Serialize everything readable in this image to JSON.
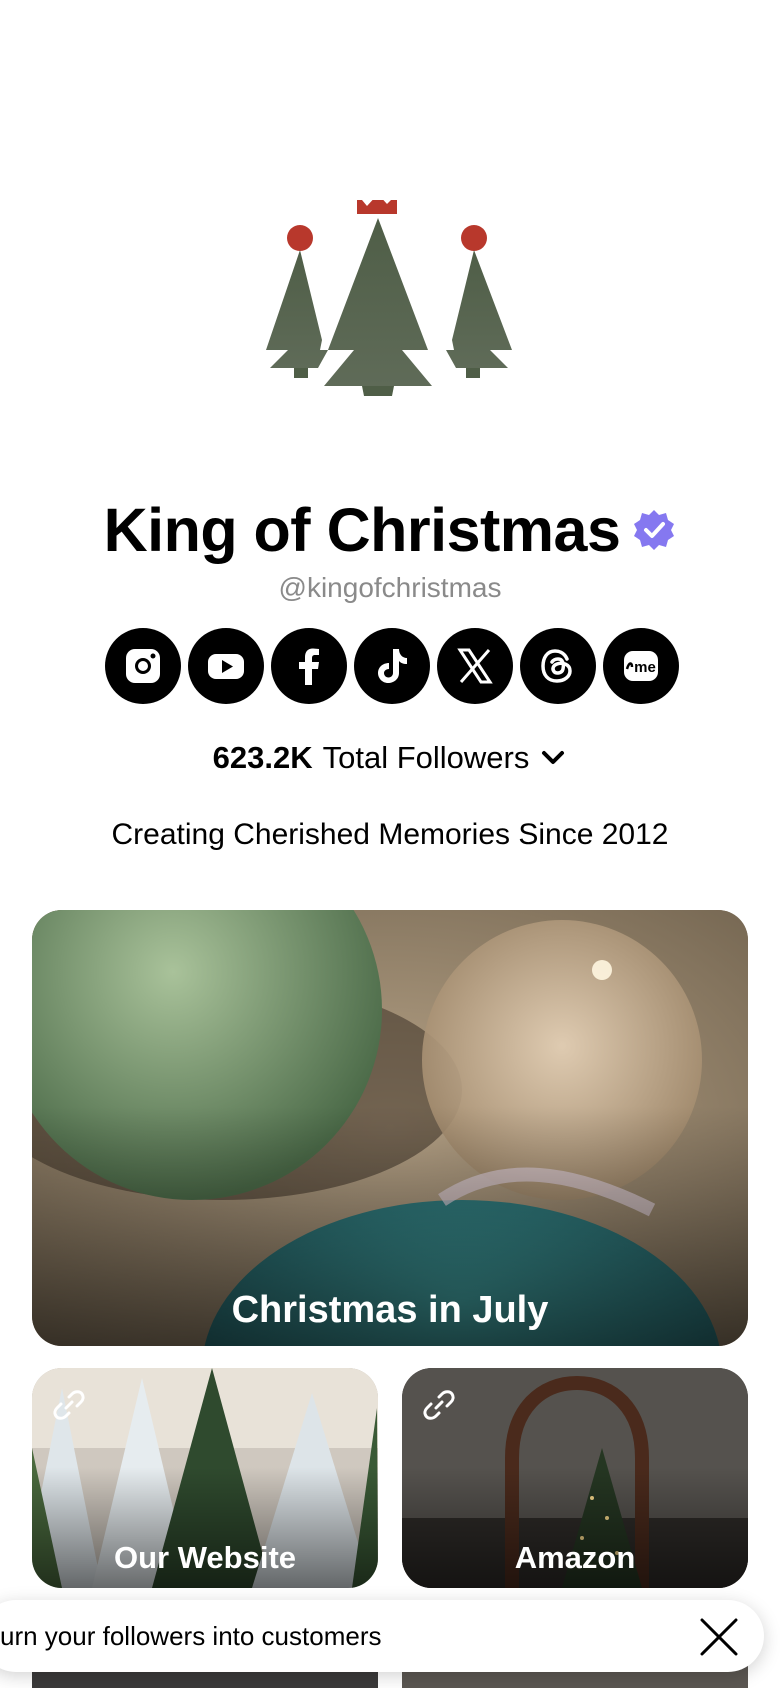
{
  "profile": {
    "name": "King of Christmas",
    "handle": "@kingofchristmas",
    "followers_count": "623.2K",
    "followers_label": "Total Followers",
    "tagline": "Creating Cherished Memories Since 2012"
  },
  "socials": [
    {
      "name": "instagram-icon"
    },
    {
      "name": "youtube-icon"
    },
    {
      "name": "facebook-icon"
    },
    {
      "name": "tiktok-icon"
    },
    {
      "name": "x-icon"
    },
    {
      "name": "threads-icon"
    },
    {
      "name": "linkme-icon",
      "text": "me"
    }
  ],
  "cards": {
    "featured": "Christmas in July",
    "website": "Our Website",
    "amazon": "Amazon"
  },
  "banner": {
    "text": "urn your followers into customers"
  },
  "colors": {
    "tree_green": "#4f5e47",
    "accent_red": "#b8382c",
    "verified_purple": "#8578f0"
  }
}
